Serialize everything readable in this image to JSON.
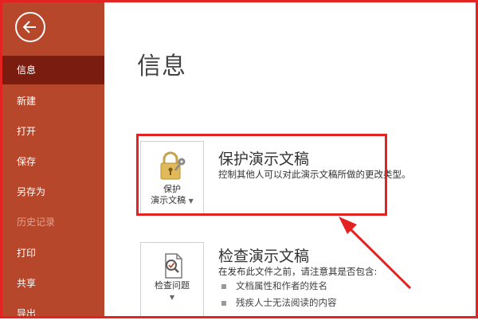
{
  "sidebar": {
    "items": [
      {
        "label": "信息"
      },
      {
        "label": "新建"
      },
      {
        "label": "打开"
      },
      {
        "label": "保存"
      },
      {
        "label": "另存为"
      },
      {
        "label": "历史记录"
      },
      {
        "label": "打印"
      },
      {
        "label": "共享"
      },
      {
        "label": "导出"
      }
    ],
    "active_index": 0,
    "disabled_index": 5
  },
  "main": {
    "title": "信息",
    "protect": {
      "button_line1": "保护",
      "button_line2": "演示文稿",
      "title": "保护演示文稿",
      "description": "控制其他人可以对此演示文稿所做的更改类型。"
    },
    "inspect": {
      "button_label": "检查问题",
      "title": "检查演示文稿",
      "description": "在发布此文件之前，请注意其是否包含:",
      "bullets": [
        "文档属性和作者的姓名",
        "残疾人士无法阅读的内容"
      ]
    }
  },
  "colors": {
    "sidebar_bg": "#b7472a",
    "sidebar_active": "#7a1d10",
    "annotation": "#e52222"
  },
  "icons": {
    "back": "back-arrow-icon",
    "protect": "lock-key-icon",
    "inspect": "inspect-document-icon"
  }
}
